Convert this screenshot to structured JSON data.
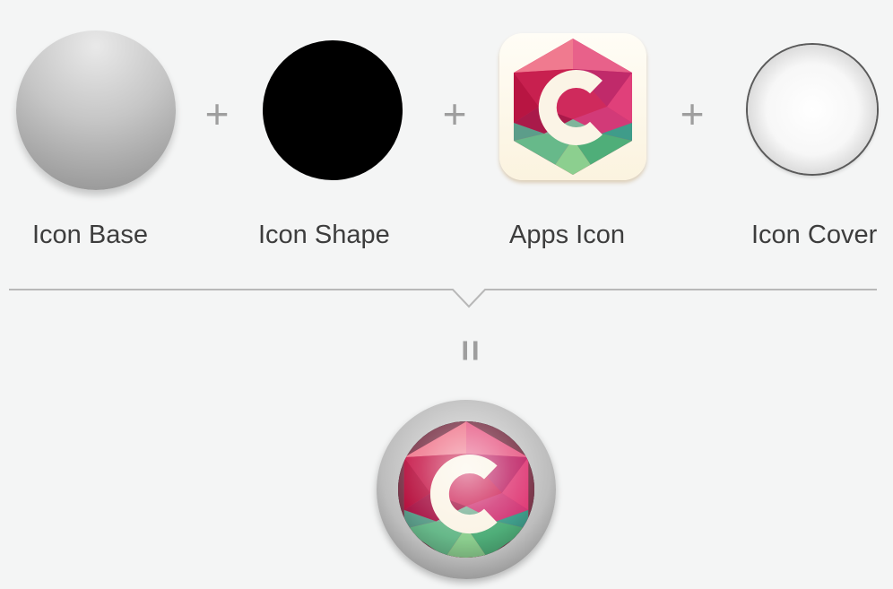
{
  "labels": {
    "base": "Icon Base",
    "shape": "Icon Shape",
    "apps": "Apps Icon",
    "cover": "Icon Cover"
  },
  "operators": {
    "plus": "+",
    "equals": "="
  },
  "icon_letter": "C",
  "colors": {
    "background": "#f4f5f5",
    "label": "#3d3d3d",
    "operator": "#9e9e9e",
    "divider": "#b8b8b8",
    "shape": "#000000",
    "hex_pink": "#d7346a",
    "hex_red": "#b81542",
    "hex_green": "#5fb47c",
    "letter": "#fbf4e6"
  },
  "icons": {
    "base": "gradient-circle-icon",
    "shape": "black-circle-icon",
    "apps": "hexagon-c-logo-icon",
    "cover": "glass-cover-circle-icon",
    "result": "composited-round-c-icon"
  }
}
